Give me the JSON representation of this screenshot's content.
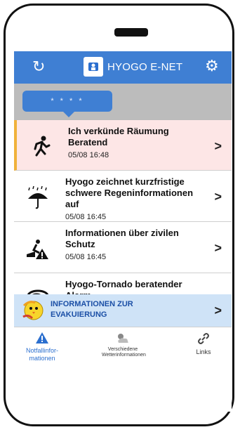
{
  "header": {
    "title": "HYOGO E-NET",
    "refresh_icon": "refresh-icon",
    "settings_icon": "gear-icon"
  },
  "banner": {
    "bubble_text": "* * * *"
  },
  "items": [
    {
      "title": "Ich verkünde Räumung Beratend",
      "time": "05/08 16:48",
      "icon": "running-person-icon"
    },
    {
      "title": "Hyogo zeichnet kurzfristige schwere Regeninformationen auf",
      "time": "05/08 16:45",
      "icon": "rain-umbrella-icon"
    },
    {
      "title": "Informationen über zivilen Schutz",
      "time": "05/08 16:45",
      "icon": "civil-protection-icon"
    },
    {
      "title": "Hyogo-Tornado beratender Alarm",
      "time": "",
      "icon": "tornado-icon"
    }
  ],
  "evac": {
    "label": "INFORMATIONEN ZUR EVAKUIERUNG",
    "icon": "mascot-bird-icon"
  },
  "nav": {
    "tab1": "Notfallinfor-mationen",
    "tab2": "Verschiedene Wetterinformationen",
    "tab3": "Links"
  },
  "colors": {
    "primary": "#3f7fd3",
    "alert_bg": "#fde6e6",
    "alert_accent": "#f0b23b"
  }
}
